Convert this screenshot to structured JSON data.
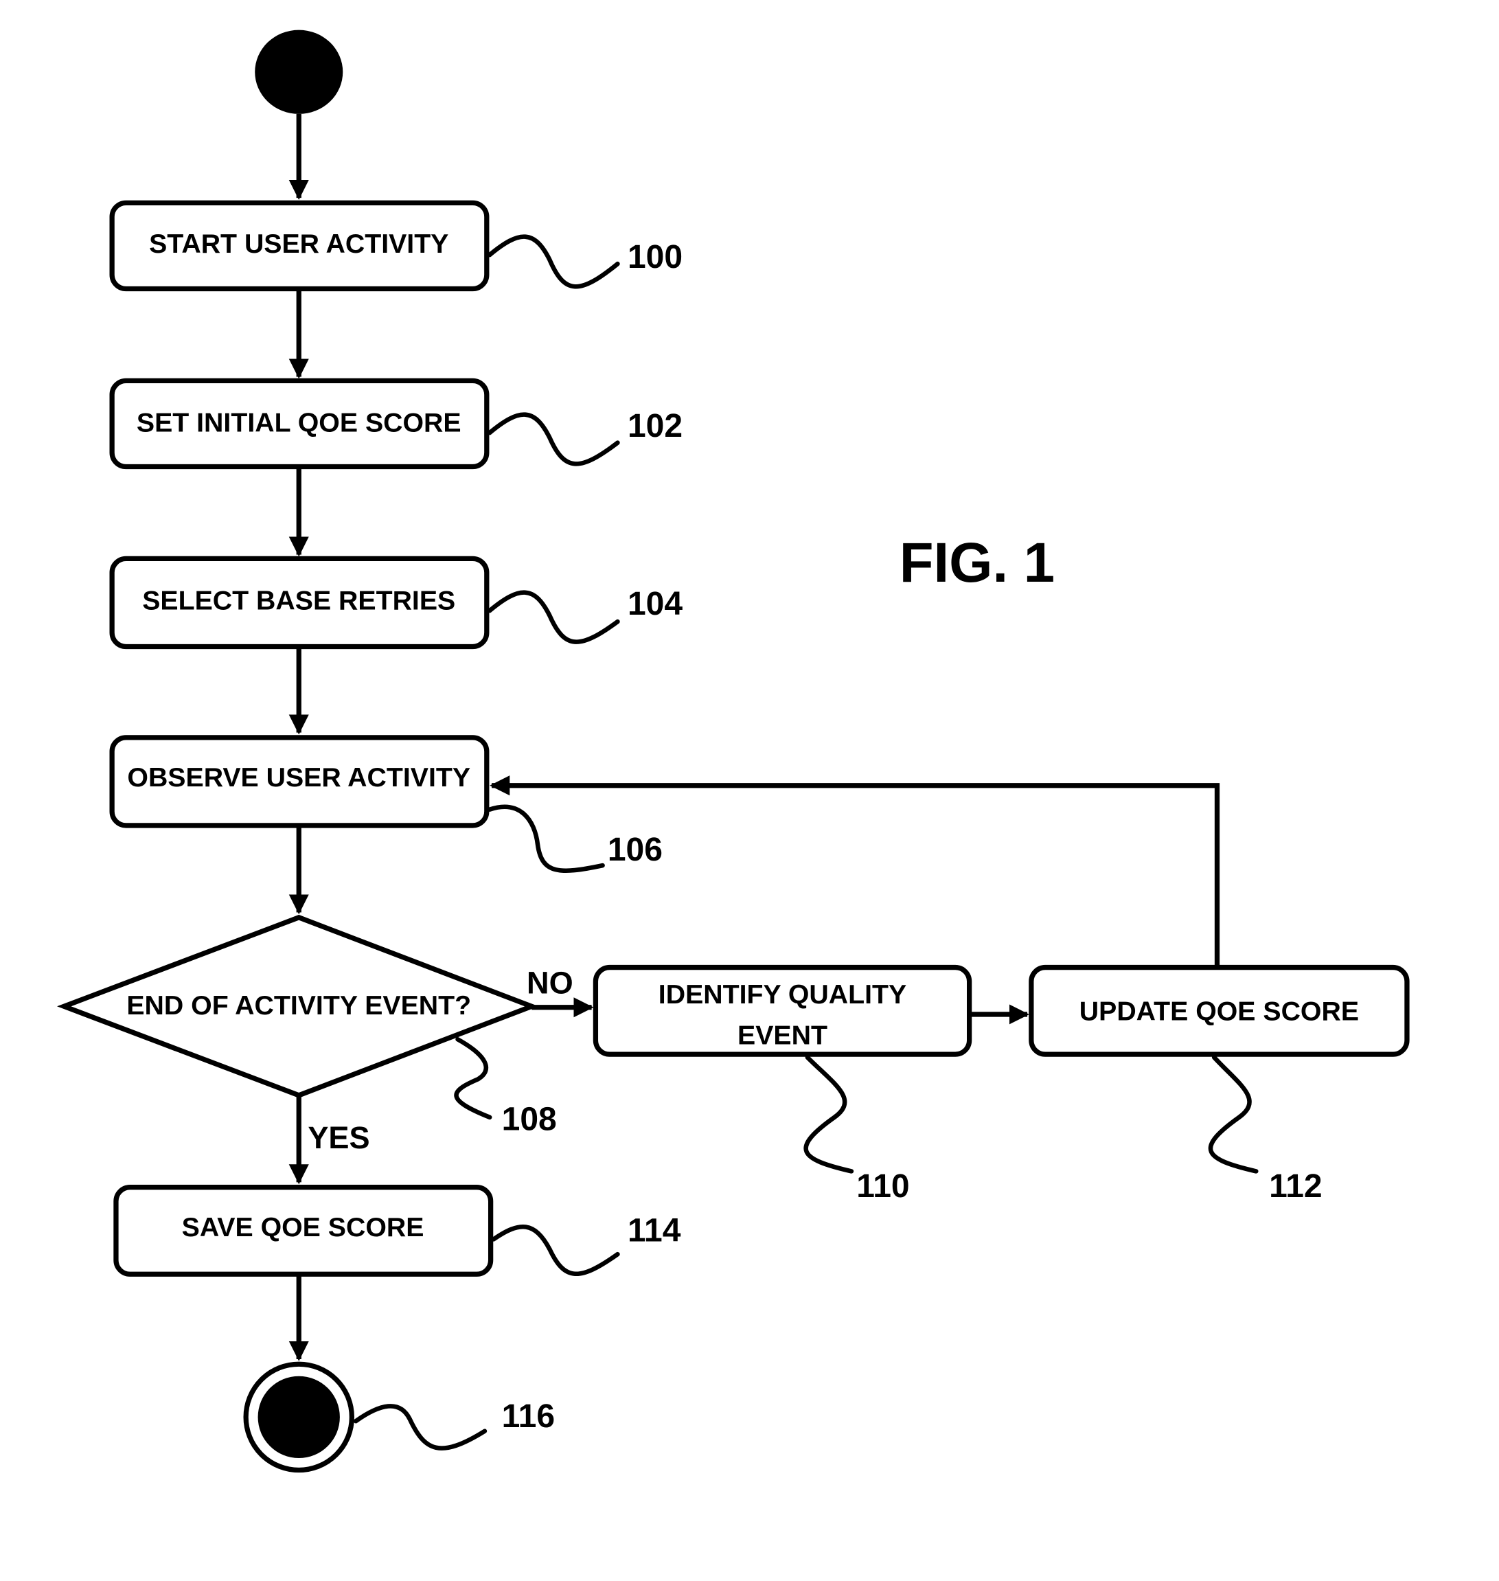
{
  "figure": {
    "title": "FIG. 1"
  },
  "nodes": {
    "start_activity": {
      "label": "START USER ACTIVITY",
      "ref": "100"
    },
    "set_initial_score": {
      "label": "SET INITIAL QOE SCORE",
      "ref": "102"
    },
    "select_base_retries": {
      "label": "SELECT BASE RETRIES",
      "ref": "104"
    },
    "observe_activity": {
      "label": "OBSERVE USER ACTIVITY",
      "ref": "106"
    },
    "end_event_decision": {
      "label": "END OF ACTIVITY EVENT?",
      "ref": "108"
    },
    "identify_quality_event": {
      "label_line1": "IDENTIFY QUALITY",
      "label_line2": "EVENT",
      "ref": "110"
    },
    "update_score": {
      "label": "UPDATE QOE SCORE",
      "ref": "112"
    },
    "save_score": {
      "label": "SAVE QOE SCORE",
      "ref": "114"
    },
    "end_node": {
      "ref": "116"
    }
  },
  "branches": {
    "no": "NO",
    "yes": "YES"
  }
}
